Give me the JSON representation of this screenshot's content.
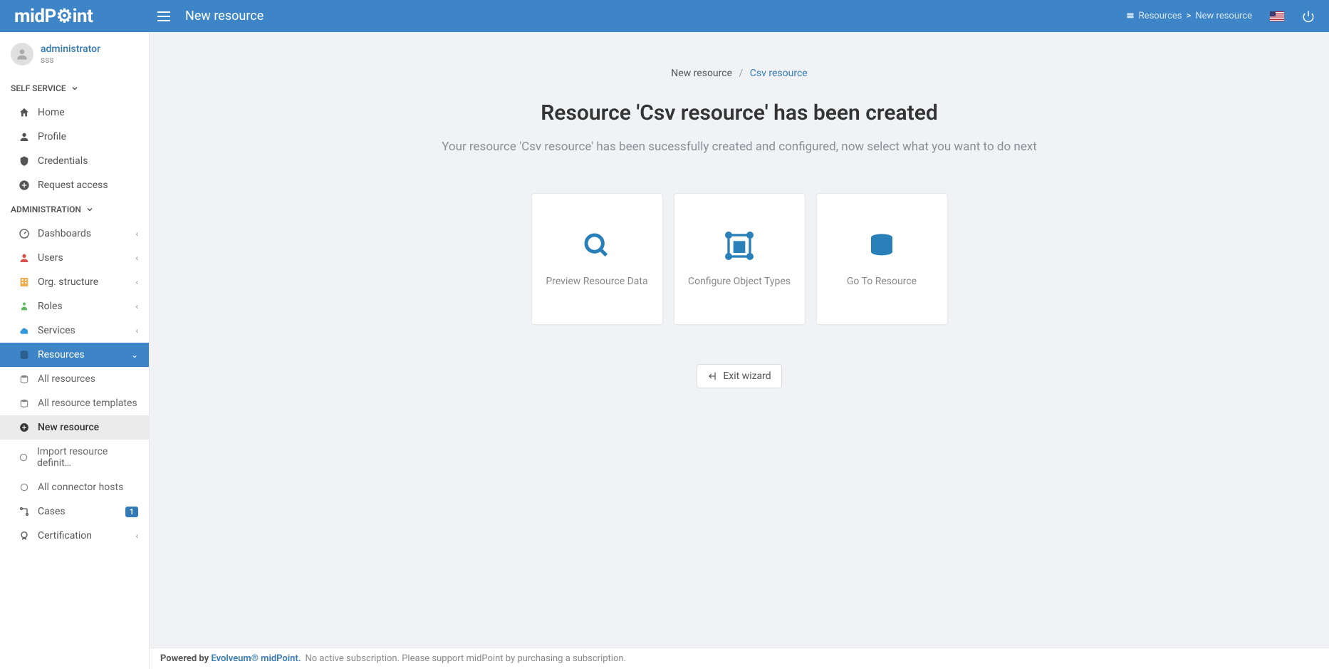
{
  "header": {
    "logo": "midPoint",
    "page_title": "New resource",
    "breadcrumb": {
      "root": "Resources",
      "current": "New resource"
    }
  },
  "user": {
    "name": "administrator",
    "subtitle": "sss"
  },
  "sidebar": {
    "sections": {
      "self_service": {
        "label": "SELF SERVICE"
      },
      "administration": {
        "label": "ADMINISTRATION"
      }
    },
    "self_items": {
      "home": "Home",
      "profile": "Profile",
      "credentials": "Credentials",
      "request_access": "Request access"
    },
    "admin_items": {
      "dashboards": "Dashboards",
      "users": "Users",
      "org_structure": "Org. structure",
      "roles": "Roles",
      "services": "Services",
      "resources": "Resources",
      "cases": "Cases",
      "certification": "Certification"
    },
    "resource_subs": {
      "all_resources": "All resources",
      "all_templates": "All resource templates",
      "new_resource": "New resource",
      "import_def": "Import resource definit…",
      "all_hosts": "All connector hosts"
    },
    "cases_badge": "1"
  },
  "main": {
    "crumb_parent": "New resource",
    "crumb_current": "Csv resource",
    "heading": "Resource 'Csv resource' has been created",
    "subtitle": "Your resource 'Csv resource' has been sucessfully created and configured, now select what you want to do next",
    "tiles": {
      "preview": "Preview Resource Data",
      "configure": "Configure Object Types",
      "goto": "Go To Resource"
    },
    "exit_label": "Exit wizard"
  },
  "footer": {
    "powered": "Powered by",
    "brand": "Evolveum® midPoint.",
    "msg": "No active subscription. Please support midPoint by purchasing a subscription."
  }
}
